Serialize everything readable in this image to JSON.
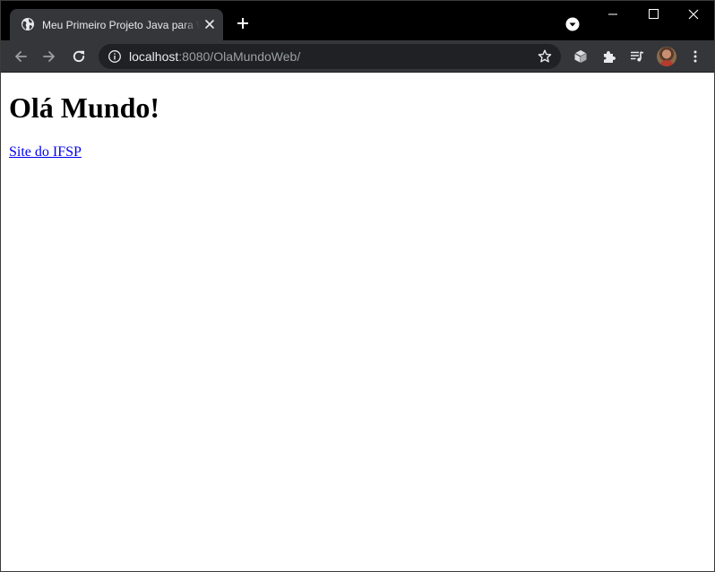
{
  "browser": {
    "tab": {
      "title": "Meu Primeiro Projeto Java para Web"
    },
    "address_bar": {
      "host": "localhost",
      "rest": ":8080/OlaMundoWeb/"
    }
  },
  "page": {
    "heading": "Olá Mundo!",
    "link_text": "Site do IFSP"
  },
  "icons": {
    "favicon": "globe-icon",
    "tab_close": "close-icon",
    "new_tab": "plus-icon",
    "tab_search": "chevron-down-icon",
    "minimize": "minimize-icon",
    "maximize": "maximize-icon",
    "close": "close-icon",
    "back": "arrow-left-icon",
    "forward": "arrow-right-icon",
    "reload": "reload-icon",
    "site_info": "info-icon",
    "bookmark": "star-icon",
    "extension_1": "cube-icon",
    "extensions": "puzzle-icon",
    "media": "media-queue-icon",
    "menu": "kebab-icon"
  },
  "colors": {
    "tabstrip": "#000000",
    "toolbar": "#35363a",
    "omnibox": "#202124",
    "link": "#0000ee"
  }
}
